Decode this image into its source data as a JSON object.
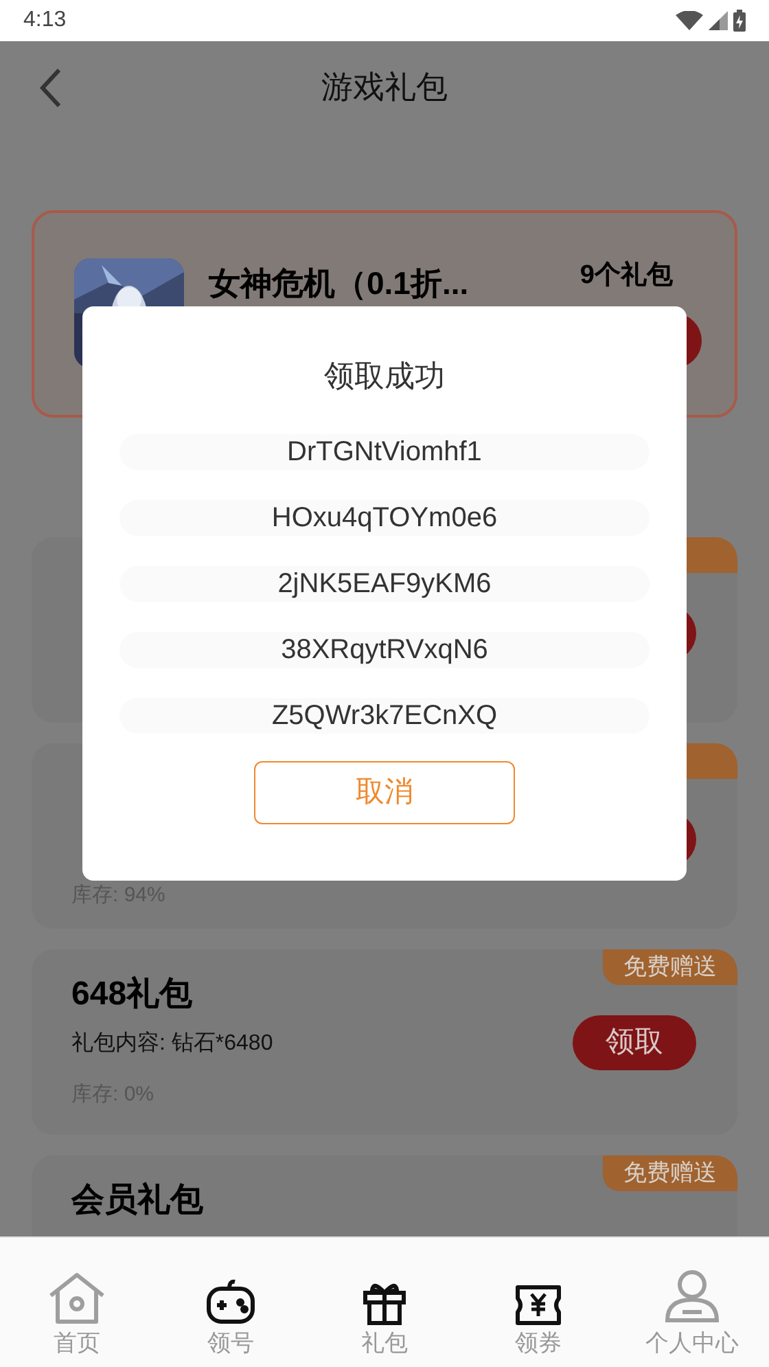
{
  "status_bar": {
    "time": "4:13"
  },
  "header": {
    "title": "游戏礼包"
  },
  "game": {
    "name": "女神危机（0.1折...",
    "gift_count": "9个礼包"
  },
  "gifts": [
    {
      "kind": "hidden"
    },
    {
      "kind": "hidden",
      "stock": "库存: 94%"
    },
    {
      "kind": "full",
      "title": "648礼包",
      "content": "礼包内容: 钻石*6480",
      "stock": "库存: 0%",
      "badge": "免费赠送",
      "claim": "领取"
    },
    {
      "kind": "full",
      "title": "会员礼包",
      "badge": "免费赠送"
    }
  ],
  "dialog": {
    "title": "领取成功",
    "codes": [
      "DrTGNtViomhf1",
      "HOxu4qTOYm0e6",
      "2jNK5EAF9yKM6",
      "38XRqytRVxqN6",
      "Z5QWr3k7ECnXQ"
    ],
    "cancel": "取消"
  },
  "bottom_nav": [
    {
      "label": "首页",
      "kind": "home"
    },
    {
      "label": "领号",
      "kind": "gamepad"
    },
    {
      "label": "礼包",
      "kind": "gift"
    },
    {
      "label": "领券",
      "kind": "ticket"
    },
    {
      "label": "个人中心",
      "kind": "user"
    }
  ]
}
